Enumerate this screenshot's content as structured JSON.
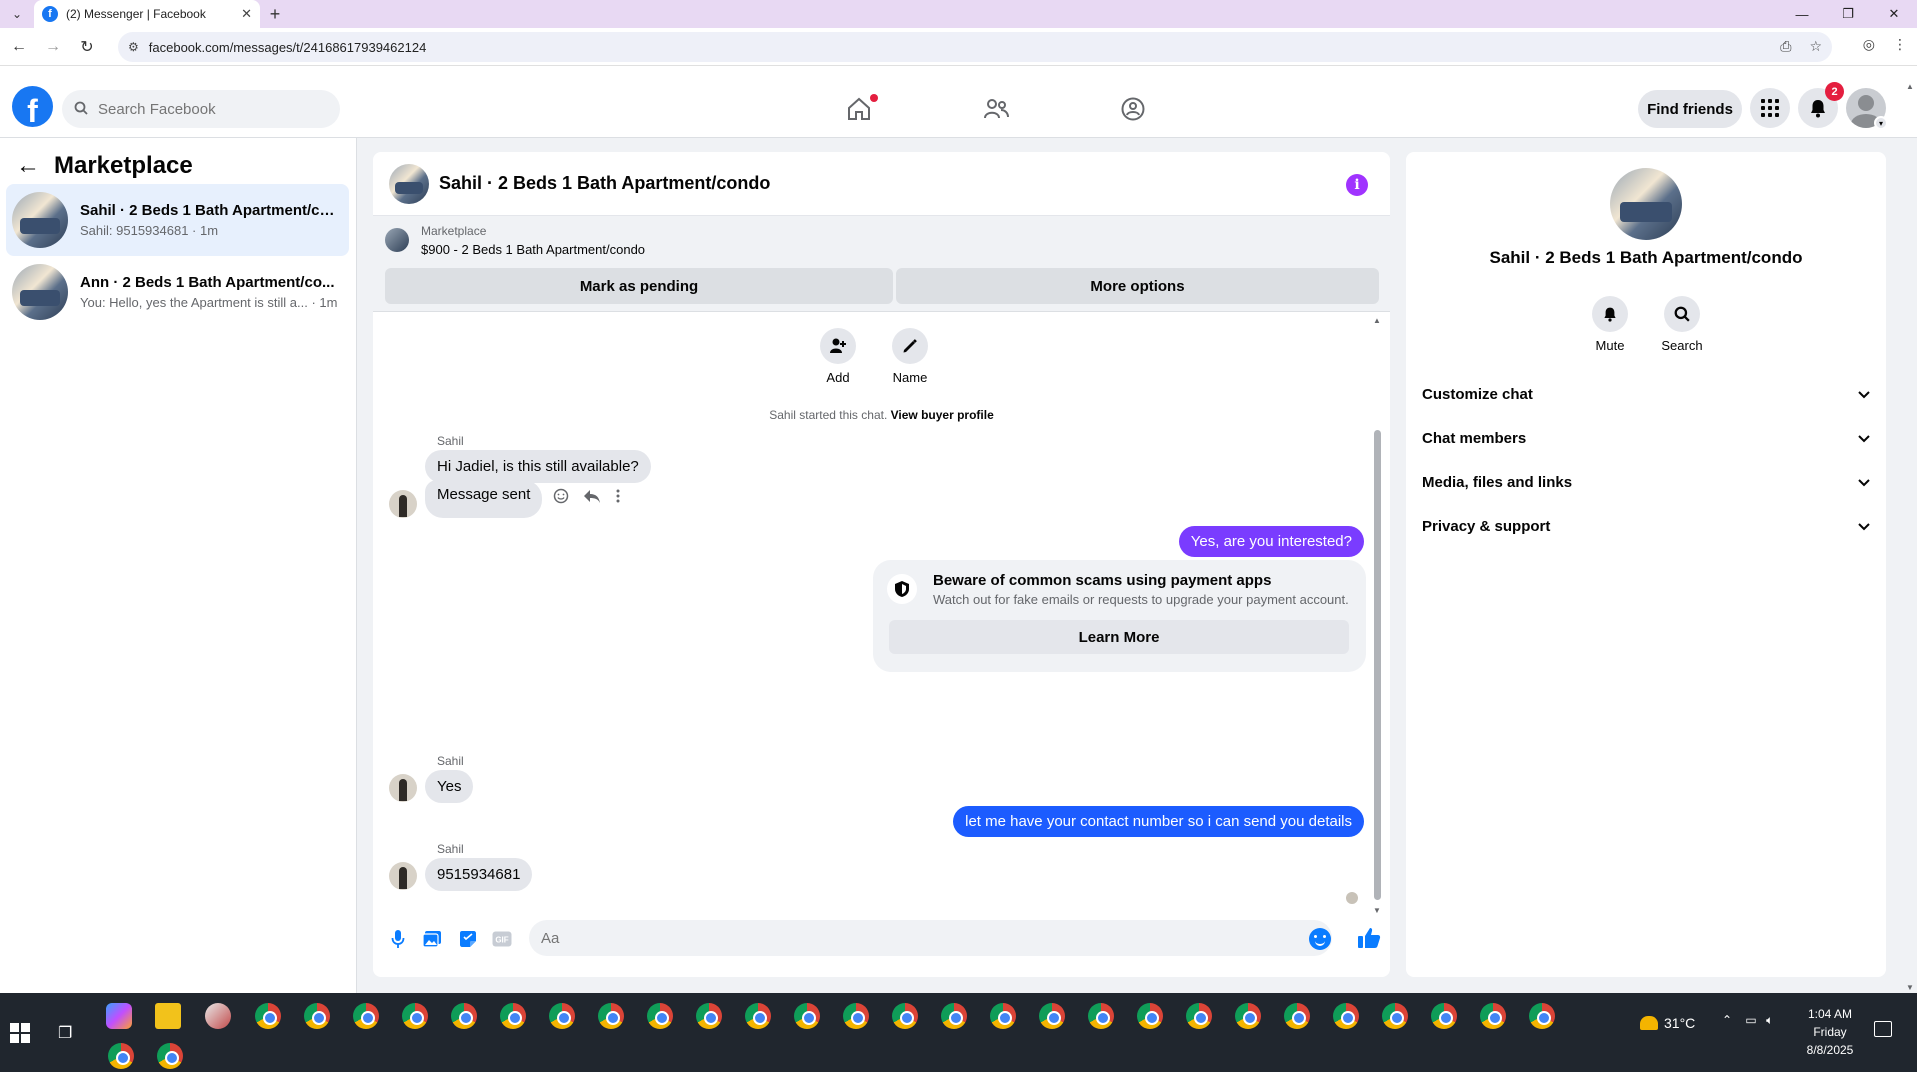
{
  "browser": {
    "tab_title": "(2) Messenger | Facebook",
    "tab_favicon": "f",
    "url": "facebook.com/messages/t/24168617939462124"
  },
  "fb": {
    "logo_letter": "f",
    "search_placeholder": "Search Facebook",
    "find_friends_label": "Find friends",
    "notifications_count": "2",
    "accent": "#1877f2"
  },
  "sidebar": {
    "title": "Marketplace",
    "chats": [
      {
        "name": "Sahil · 2 Beds 1 Bath Apartment/co...",
        "preview": "Sahil: 9515934681 · 1m"
      },
      {
        "name": "Ann · 2 Beds 1 Bath Apartment/co...",
        "preview": "You: Hello, yes the Apartment is still a... · 1m"
      }
    ]
  },
  "chat": {
    "title": "Sahil · 2 Beds 1 Bath Apartment/condo",
    "marketplace_label": "Marketplace",
    "listing": "$900 - 2 Beds 1 Bath Apartment/condo",
    "mark_pending_label": "Mark as pending",
    "more_options_label": "More options",
    "add_label": "Add",
    "name_label": "Name",
    "system_text": "Sahil started this chat. ",
    "view_profile_label": "View buyer profile",
    "messages": [
      {
        "sender": "Sahil",
        "text": "Hi Jadiel, is this still available?"
      },
      {
        "text": "Message sent"
      },
      {
        "text": "Yes, are you interested?",
        "color": "#7a3cff"
      },
      {
        "sender": "Sahil",
        "text": "Yes"
      },
      {
        "text": "let me have your contact number so i can send you details",
        "color": "#1c5cff"
      },
      {
        "sender": "Sahil",
        "text": "9515934681"
      }
    ],
    "scam_title": "Beware of common scams using payment apps",
    "scam_sub": "Watch out for fake emails or requests to upgrade your payment account.",
    "learn_more_label": "Learn More",
    "composer_placeholder": "Aa"
  },
  "details": {
    "name": "Sahil · 2 Beds 1 Bath Apartment/condo",
    "mute_label": "Mute",
    "search_label": "Search",
    "sections": [
      "Customize chat",
      "Chat members",
      "Media, files and links",
      "Privacy & support"
    ]
  },
  "taskbar": {
    "temperature": "31°C",
    "time": "1:04 AM",
    "day": "Friday",
    "date": "8/8/2025"
  }
}
